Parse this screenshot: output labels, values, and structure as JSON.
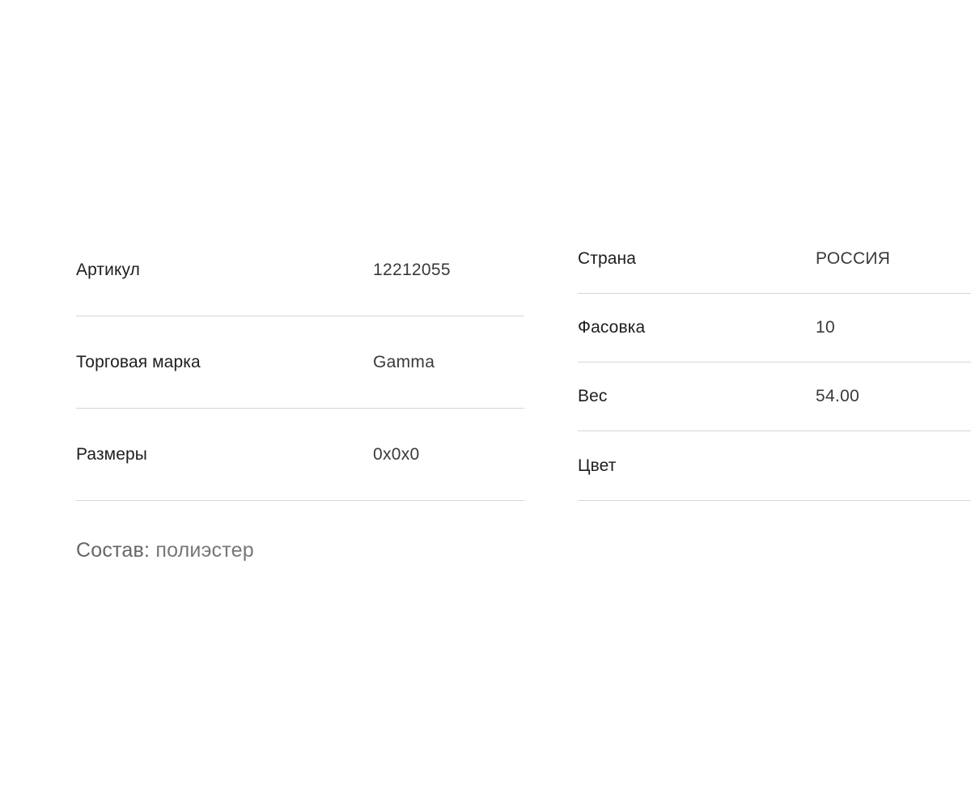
{
  "specs_left": [
    {
      "label": "Артикул",
      "value": "12212055"
    },
    {
      "label": "Торговая марка",
      "value": "Gamma"
    },
    {
      "label": "Размеры",
      "value": "0x0x0"
    }
  ],
  "specs_right": [
    {
      "label": "Страна",
      "value": "РОССИЯ"
    },
    {
      "label": "Фасовка",
      "value": "10"
    },
    {
      "label": "Вес",
      "value": "54.00"
    },
    {
      "label": "Цвет",
      "value": ""
    }
  ],
  "composition": {
    "label": "Состав:",
    "value": "полиэстер"
  },
  "colors": {
    "divider": "#d6d6d6",
    "label_text": "#1e1e1e",
    "value_text": "#3a3a3a",
    "composition_text": "#6c6c6c"
  }
}
